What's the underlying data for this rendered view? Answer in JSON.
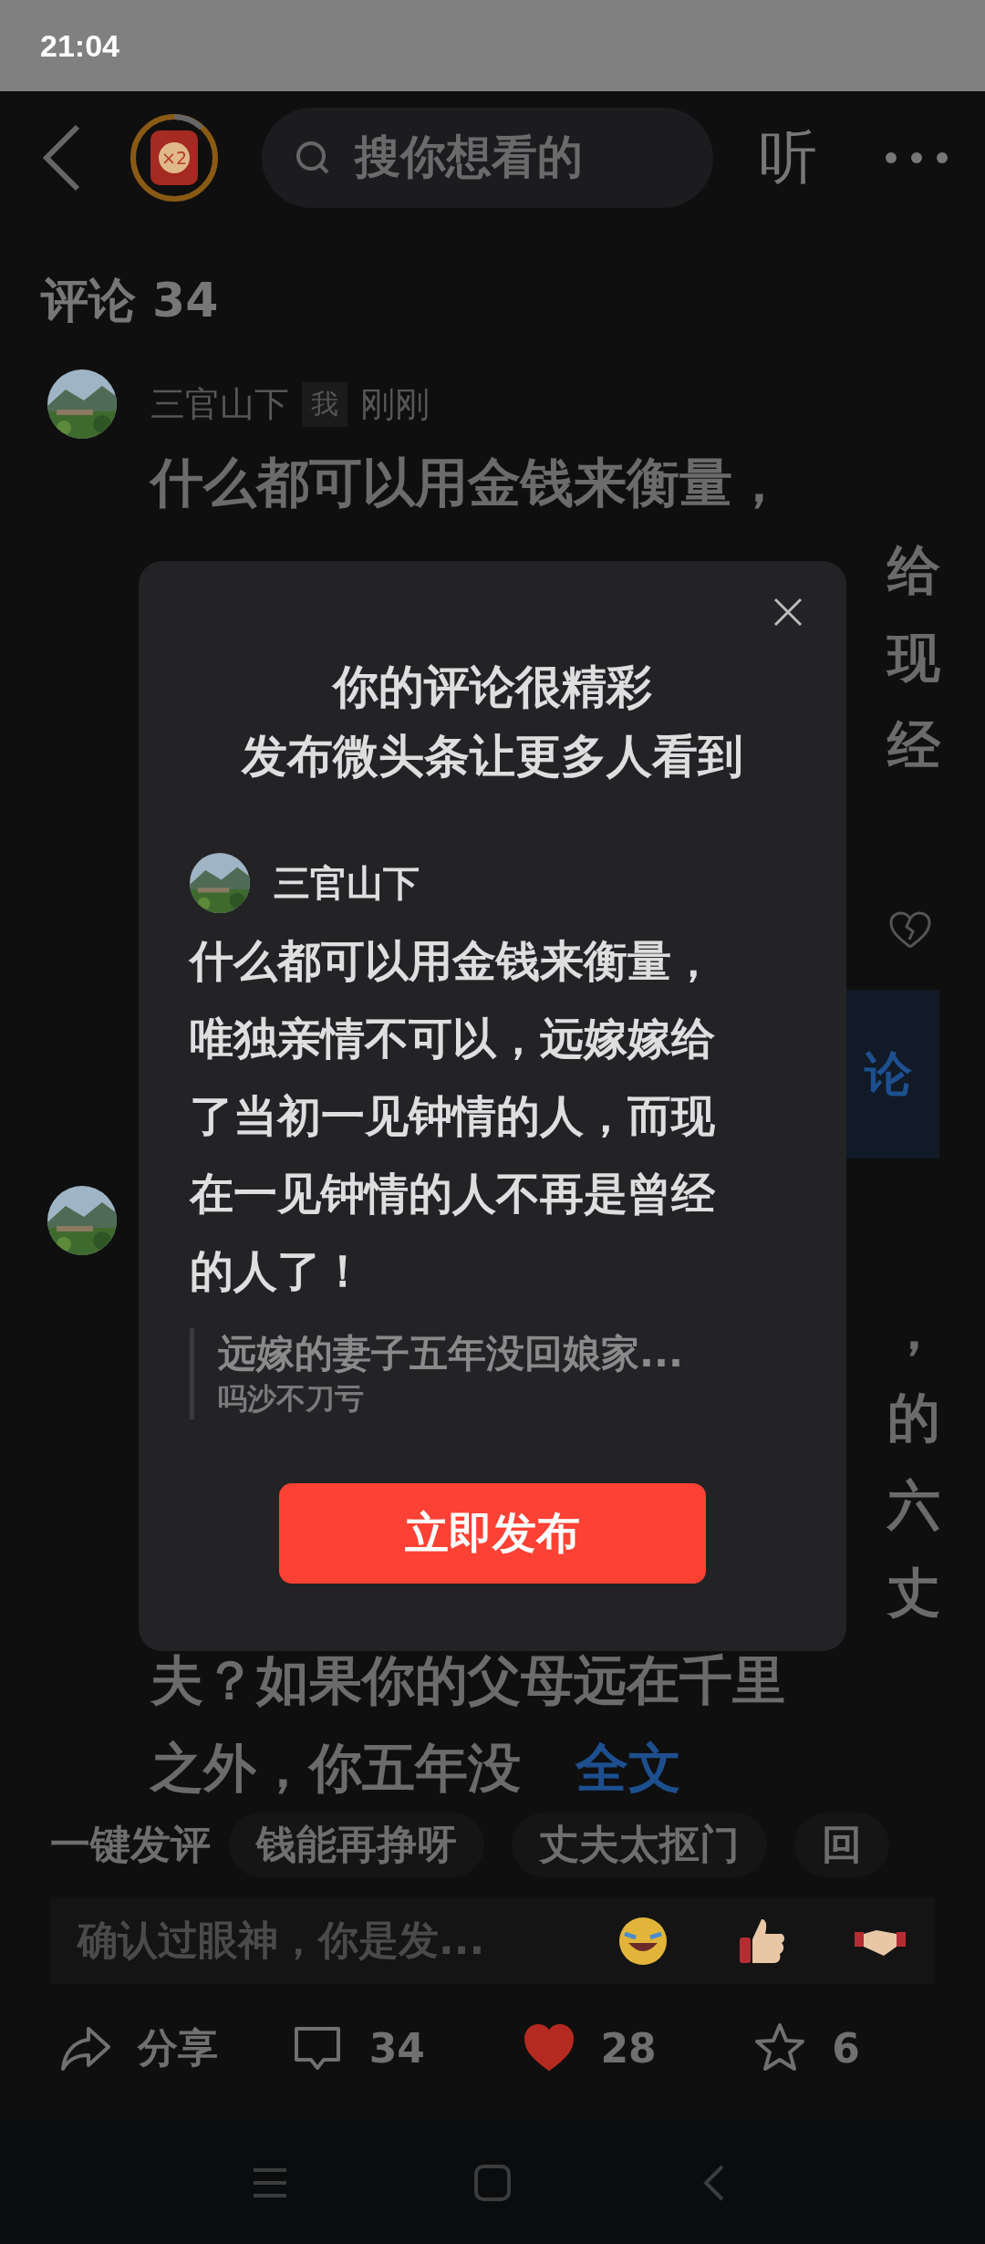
{
  "status_bar": {
    "time": "21:04"
  },
  "header": {
    "reward_badge": "×2",
    "search_placeholder": "搜你想看的",
    "listen_label": "听"
  },
  "comments_title": "评论 34",
  "comments": [
    {
      "author": "三官山下",
      "tag": "我",
      "time": "刚刚",
      "lines": [
        {
          "text": "什么都可以用金钱来衡量，",
          "kind": "full"
        },
        {
          "text": "给",
          "kind": "fragment"
        },
        {
          "text": "现",
          "kind": "fragment"
        },
        {
          "text": "经",
          "kind": "fragment"
        }
      ]
    },
    {
      "lines": [
        {
          "text": "，",
          "kind": "fragment"
        },
        {
          "text": "的",
          "kind": "fragment"
        },
        {
          "text": "六",
          "kind": "fragment"
        },
        {
          "text": "丈",
          "kind": "fragment"
        },
        {
          "text": "夫？如果你的父母远在千里",
          "kind": "full"
        },
        {
          "text": "之外，你五年没",
          "kind": "full",
          "link": "全文"
        }
      ]
    }
  ],
  "discuss_button": "论",
  "modal": {
    "title_lines": [
      "你的评论很精彩",
      "发布微头条让更多人看到"
    ],
    "author": "三官山下",
    "body": "什么都可以用金钱来衡量，唯独亲情不可以，远嫁嫁给了当初一见钟情的人，而现在一见钟情的人不再是曾经的人了！",
    "quote_title": "远嫁的妻子五年没回娘家...",
    "quote_subtitle": "吗沙不刀亏",
    "button": "立即发布"
  },
  "quick_replies": [
    {
      "text": "一键发评",
      "kind": "label"
    },
    {
      "text": "钱能再挣呀",
      "kind": "chip"
    },
    {
      "text": "丈夫太抠门",
      "kind": "chip"
    },
    {
      "text": "回",
      "kind": "chip"
    }
  ],
  "input": {
    "placeholder": "确认过眼神，你是发..."
  },
  "actions": [
    {
      "kind": "share",
      "label": "分享"
    },
    {
      "kind": "comment",
      "label": "34"
    },
    {
      "kind": "like",
      "label": "28",
      "selected": true
    },
    {
      "kind": "favorite",
      "label": "6",
      "selected": false
    }
  ]
}
